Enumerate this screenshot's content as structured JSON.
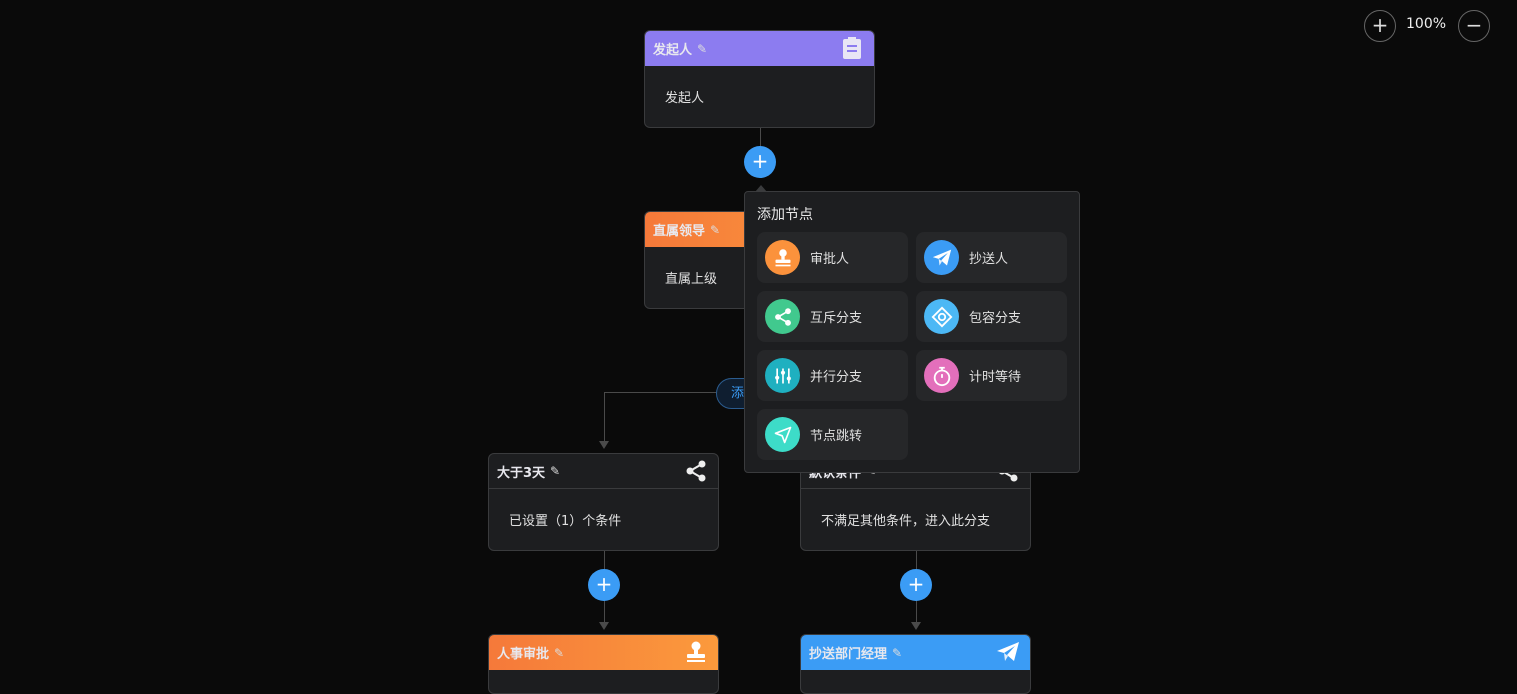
{
  "zoom": {
    "level": "100%",
    "zoom_in": "+",
    "zoom_out": "−"
  },
  "nodes": {
    "start": {
      "title": "发起人",
      "body": "发起人",
      "color": "#8c7cf0"
    },
    "leader": {
      "title": "直属领导",
      "body": "直属上级",
      "color": "#f5793a"
    },
    "add_condition": "添加条件",
    "cond1": {
      "title": "大于3天",
      "body": "已设置（1）个条件"
    },
    "cond2": {
      "title": "默认条件",
      "body": "不满足其他条件，进入此分支"
    },
    "hr": {
      "title": "人事审批",
      "color": "#f5793a"
    },
    "cc": {
      "title": "抄送部门经理",
      "color": "#3b9cf5"
    }
  },
  "popover": {
    "title": "添加节点",
    "items": [
      {
        "label": "审批人",
        "icon": "stamp-icon",
        "color": "#fb923c"
      },
      {
        "label": "抄送人",
        "icon": "paper-plane-icon",
        "color": "#3b9cf5"
      },
      {
        "label": "互斥分支",
        "icon": "share-icon",
        "color": "#41c98e"
      },
      {
        "label": "包容分支",
        "icon": "diamond-icon",
        "color": "#4cb8f5"
      },
      {
        "label": "并行分支",
        "icon": "sliders-icon",
        "color": "#1fb0c0"
      },
      {
        "label": "计时等待",
        "icon": "stopwatch-icon",
        "color": "#e36fbb"
      },
      {
        "label": "节点跳转",
        "icon": "navigation-icon",
        "color": "#3ddcc8"
      }
    ]
  }
}
